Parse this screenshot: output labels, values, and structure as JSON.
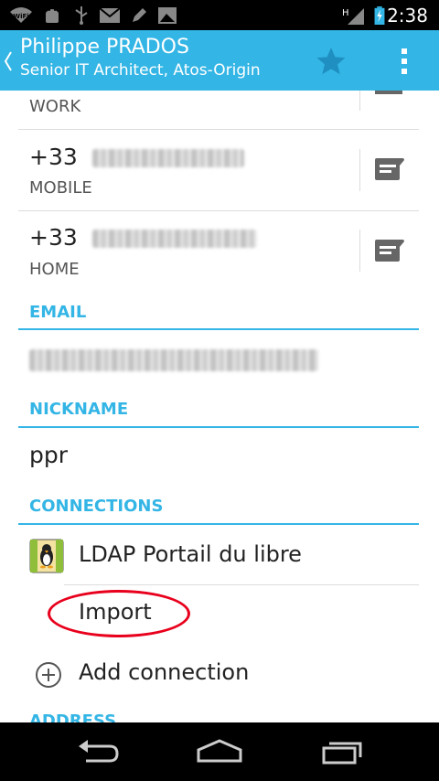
{
  "status_bar": {
    "time": "2:38",
    "icons": [
      "wifi-icon",
      "android-debug-icon",
      "usb-icon",
      "gmail-icon",
      "pencil-icon",
      "gallery-icon",
      "signal-icon",
      "battery-charging-icon"
    ],
    "network_type": "H"
  },
  "action_bar": {
    "title": "Philippe PRADOS",
    "subtitle": "Senior IT Architect, Atos-Origin",
    "icons": [
      "up-caret-icon",
      "star-icon",
      "overflow-menu-icon"
    ]
  },
  "phones": [
    {
      "number_prefix": "",
      "type": "WORK"
    },
    {
      "number_prefix": "+33",
      "type": "MOBILE"
    },
    {
      "number_prefix": "+33",
      "type": "HOME"
    }
  ],
  "email": {
    "header": "EMAIL"
  },
  "nickname": {
    "header": "NICKNAME",
    "value": "ppr"
  },
  "connections": {
    "header": "CONNECTIONS",
    "account": "LDAP Portail du libre",
    "import_label": "Import",
    "add_label": "Add connection"
  },
  "address": {
    "header": "ADDRESS"
  },
  "colors": {
    "accent": "#33b5e5",
    "highlight": "#e8001c",
    "status_bar": "#000000"
  },
  "nav_bar": {
    "icons": [
      "back-icon",
      "home-icon",
      "recent-apps-icon"
    ]
  }
}
